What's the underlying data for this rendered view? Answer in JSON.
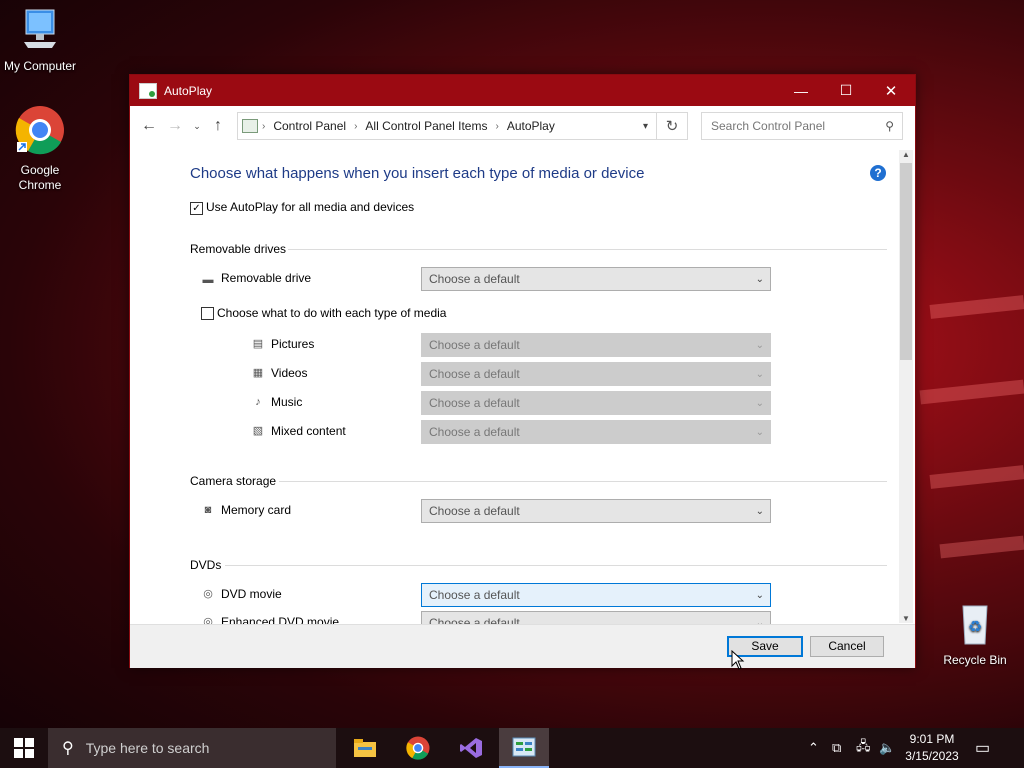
{
  "desktop": {
    "icons": [
      {
        "label": "My Computer"
      },
      {
        "label": "Google Chrome"
      },
      {
        "label": "Recycle Bin"
      }
    ]
  },
  "window": {
    "title": "AutoPlay",
    "controls": {
      "minimize": "—",
      "maximize": "☐",
      "close": "✕"
    },
    "breadcrumbs": [
      "Control Panel",
      "All Control Panel Items",
      "AutoPlay"
    ],
    "search_placeholder": "Search Control Panel",
    "heading": "Choose what happens when you insert each type of media or device",
    "use_autoplay_label": "Use AutoPlay for all media and devices",
    "use_autoplay_checked": true,
    "sections": {
      "removable": "Removable drives",
      "camera": "Camera storage",
      "dvds": "DVDs"
    },
    "rows": {
      "removable_drive": {
        "label": "Removable drive",
        "value": "Choose a default"
      },
      "media_each_label": "Choose what to do with each type of media",
      "media_each_checked": false,
      "pictures": {
        "label": "Pictures",
        "value": "Choose a default"
      },
      "videos": {
        "label": "Videos",
        "value": "Choose a default"
      },
      "music": {
        "label": "Music",
        "value": "Choose a default"
      },
      "mixed": {
        "label": "Mixed content",
        "value": "Choose a default"
      },
      "memory_card": {
        "label": "Memory card",
        "value": "Choose a default"
      },
      "dvd_movie": {
        "label": "DVD movie",
        "value": "Choose a default"
      },
      "enhanced_dvd": {
        "label": "Enhanced DVD movie",
        "value": "Choose a default"
      }
    },
    "buttons": {
      "save": "Save",
      "cancel": "Cancel"
    }
  },
  "taskbar": {
    "search_placeholder": "Type here to search",
    "time": "9:01 PM",
    "date": "3/15/2023"
  },
  "colors": {
    "titlebar": "#9b0a12",
    "heading": "#1e3b87",
    "accent": "#0078d7"
  }
}
